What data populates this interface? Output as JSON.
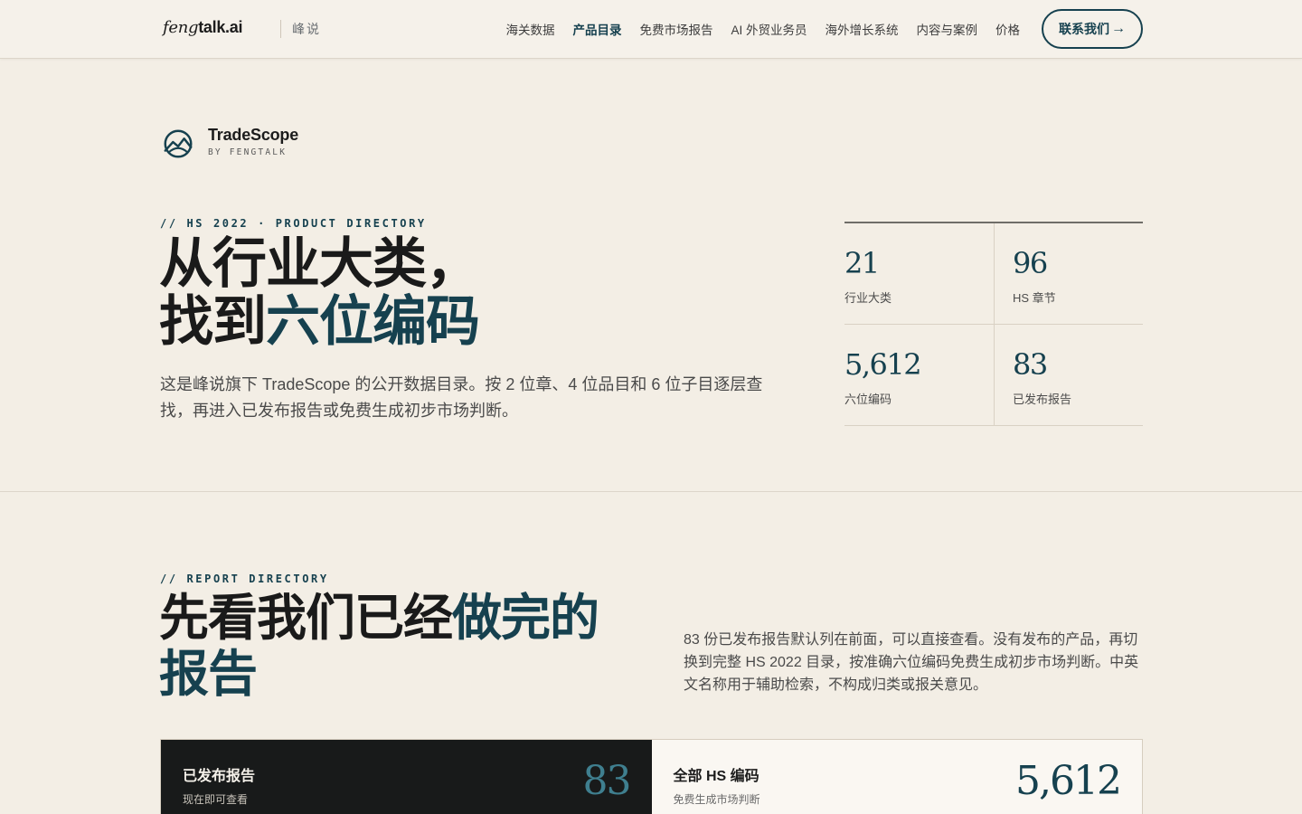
{
  "header": {
    "logo_italic": "feng",
    "logo_bold": "talk.ai",
    "brand_sub": "峰说",
    "nav": [
      {
        "label": "海关数据",
        "active": false
      },
      {
        "label": "产品目录",
        "active": true
      },
      {
        "label": "免费市场报告",
        "active": false
      },
      {
        "label": "AI 外贸业务员",
        "active": false
      },
      {
        "label": "海外增长系统",
        "active": false
      },
      {
        "label": "内容与案例",
        "active": false
      },
      {
        "label": "价格",
        "active": false
      }
    ],
    "cta_label": "联系我们",
    "cta_arrow": "→"
  },
  "product": {
    "name": "TradeScope",
    "byline": "BY FENGTALK",
    "icon": "tradescope-logo-icon"
  },
  "hero": {
    "eyebrow": "// HS 2022 · PRODUCT DIRECTORY",
    "title_line1": "从行业大类，",
    "title_line2_plain": "找到",
    "title_line2_accent": "六位编码",
    "description": "这是峰说旗下 TradeScope 的公开数据目录。按 2 位章、4 位品目和 6 位子目逐层查找，再进入已发布报告或免费生成初步市场判断。"
  },
  "stats": [
    {
      "value": "21",
      "label": "行业大类"
    },
    {
      "value": "96",
      "label": "HS 章节"
    },
    {
      "value": "5,612",
      "label": "六位编码"
    },
    {
      "value": "83",
      "label": "已发布报告"
    }
  ],
  "report_section": {
    "eyebrow": "// REPORT DIRECTORY",
    "title_plain": "先看我们已经",
    "title_accent": "做完的报告",
    "description": "83 份已发布报告默认列在前面，可以直接查看。没有发布的产品，再切换到完整 HS 2022 目录，按准确六位编码免费生成初步市场判断。中英文名称用于辅助检索，不构成归类或报关意见。",
    "tabs": [
      {
        "title": "已发布报告",
        "subtitle": "现在即可查看",
        "count": "83"
      },
      {
        "title": "全部 HS 编码",
        "subtitle": "免费生成市场判断",
        "count": "5,612"
      }
    ]
  },
  "colors": {
    "accent": "#16414f",
    "background": "#f3eee5",
    "dark_tab": "#181a1a"
  }
}
